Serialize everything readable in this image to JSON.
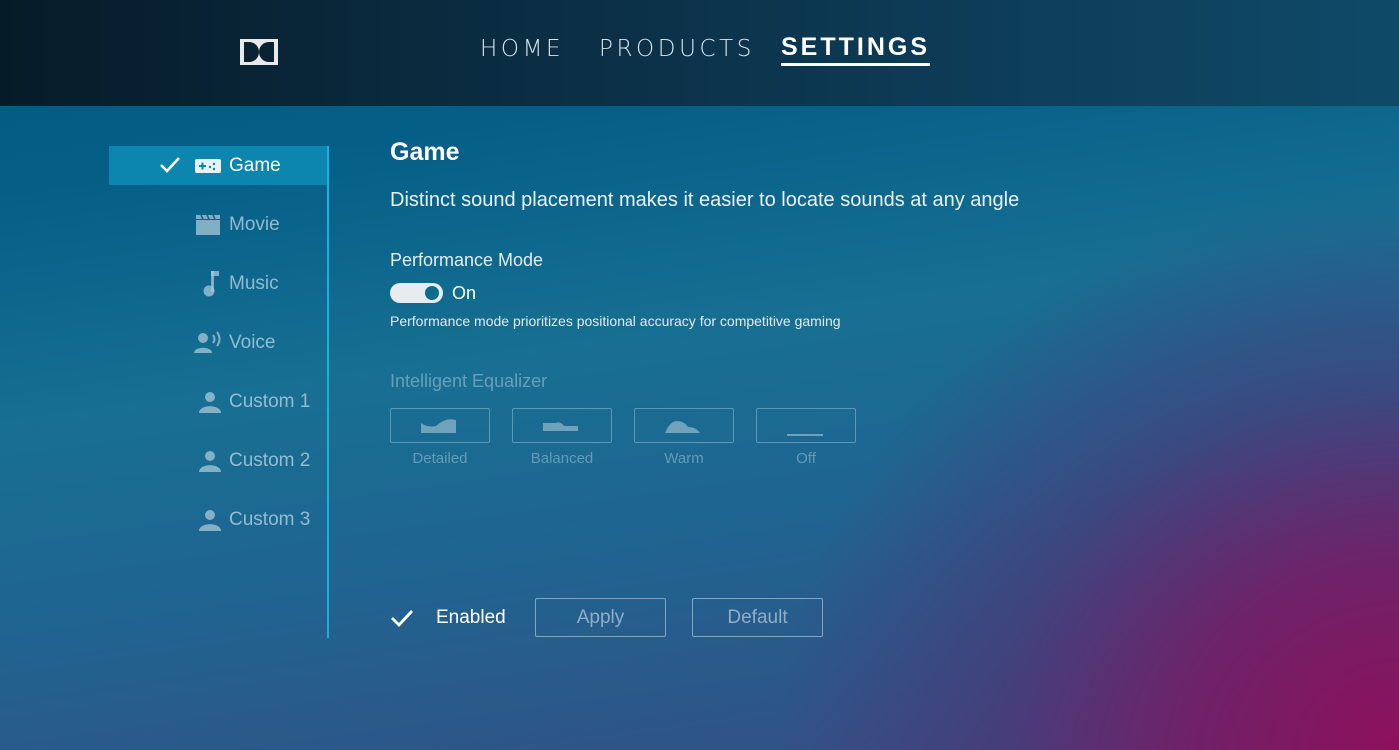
{
  "header": {
    "logo": "dolby-logo-icon",
    "nav": [
      {
        "label": "HOME",
        "active": false
      },
      {
        "label": "PRODUCTS",
        "active": false
      },
      {
        "label": "SETTINGS",
        "active": true
      }
    ]
  },
  "sidebar": {
    "items": [
      {
        "label": "Game",
        "icon": "gamepad-icon",
        "active": true,
        "checked": true
      },
      {
        "label": "Movie",
        "icon": "clapperboard-icon",
        "active": false
      },
      {
        "label": "Music",
        "icon": "music-note-icon",
        "active": false
      },
      {
        "label": "Voice",
        "icon": "voice-speaker-icon",
        "active": false
      },
      {
        "label": "Custom 1",
        "icon": "user-icon",
        "active": false
      },
      {
        "label": "Custom 2",
        "icon": "user-icon",
        "active": false
      },
      {
        "label": "Custom 3",
        "icon": "user-icon",
        "active": false
      }
    ]
  },
  "main": {
    "title": "Game",
    "description": "Distinct sound placement makes it easier to locate sounds at any angle",
    "performance_mode": {
      "label": "Performance Mode",
      "state": "On",
      "enabled": true,
      "help": "Performance mode prioritizes positional accuracy for competitive gaming"
    },
    "equalizer": {
      "label": "Intelligent Equalizer",
      "disabled": true,
      "options": [
        {
          "label": "Detailed",
          "icon": "eq-detailed-icon"
        },
        {
          "label": "Balanced",
          "icon": "eq-balanced-icon"
        },
        {
          "label": "Warm",
          "icon": "eq-warm-icon"
        },
        {
          "label": "Off",
          "icon": "eq-off-icon"
        }
      ]
    },
    "footer": {
      "enabled_label": "Enabled",
      "enabled": true,
      "apply_label": "Apply",
      "default_label": "Default"
    }
  },
  "colors": {
    "accent": "#1ab0dc",
    "active_item_bg": "#0c86ae",
    "header_bg": "#0a2a3e",
    "gradient_corner": "#8e105c"
  }
}
